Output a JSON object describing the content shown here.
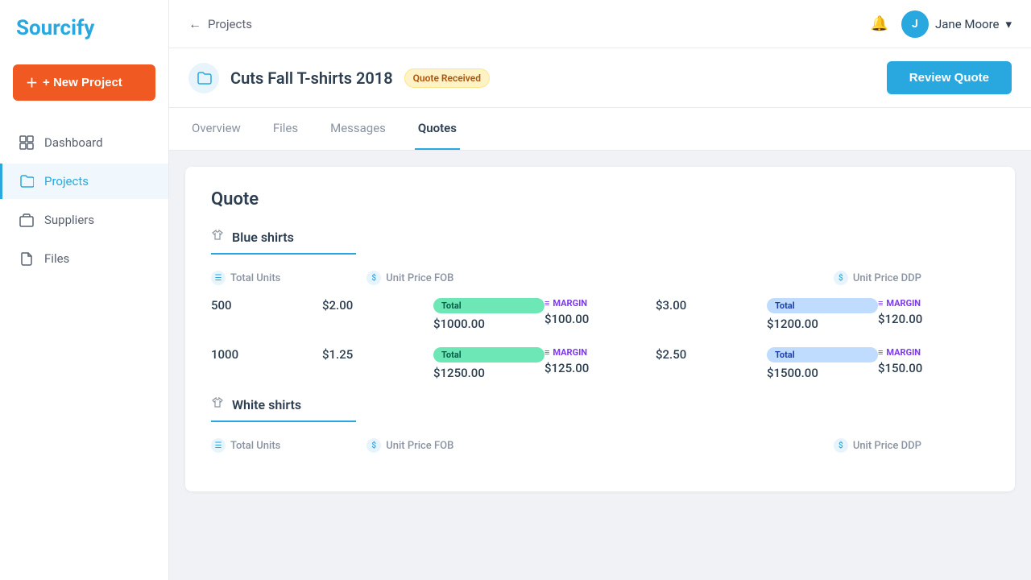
{
  "sidebar": {
    "logo": "Sourcify",
    "new_project_label": "+ New Project",
    "nav_items": [
      {
        "id": "dashboard",
        "label": "Dashboard",
        "active": false
      },
      {
        "id": "projects",
        "label": "Projects",
        "active": true
      },
      {
        "id": "suppliers",
        "label": "Suppliers",
        "active": false
      },
      {
        "id": "files",
        "label": "Files",
        "active": false
      }
    ]
  },
  "header": {
    "breadcrumb_label": "Projects",
    "notification_icon": "bell",
    "user": {
      "initial": "J",
      "name": "Jane Moore"
    }
  },
  "project": {
    "title": "Cuts Fall T-shirts 2018",
    "status": "Quote Received",
    "review_button": "Review Quote"
  },
  "tabs": [
    {
      "id": "overview",
      "label": "Overview",
      "active": false
    },
    {
      "id": "files",
      "label": "Files",
      "active": false
    },
    {
      "id": "messages",
      "label": "Messages",
      "active": false
    },
    {
      "id": "quotes",
      "label": "Quotes",
      "active": true
    }
  ],
  "quote": {
    "title": "Quote",
    "sections": [
      {
        "id": "blue-shirts",
        "name": "Blue shirts",
        "columns": {
          "total_units": "Total Units",
          "unit_price_fob": "Unit Price FOB",
          "unit_price_ddp": "Unit Price DDP"
        },
        "rows": [
          {
            "units": "500",
            "fob_price": "$2.00",
            "fob_total_label": "Total",
            "fob_total_value": "$1000.00",
            "fob_margin_label": "MARGIN",
            "fob_margin_value": "$100.00",
            "ddp_price": "$3.00",
            "ddp_total_label": "Total",
            "ddp_total_value": "$1200.00",
            "ddp_margin_label": "MARGIN",
            "ddp_margin_value": "$120.00"
          },
          {
            "units": "1000",
            "fob_price": "$1.25",
            "fob_total_label": "Total",
            "fob_total_value": "$1250.00",
            "fob_margin_label": "MARGIN",
            "fob_margin_value": "$125.00",
            "ddp_price": "$2.50",
            "ddp_total_label": "Total",
            "ddp_total_value": "$1500.00",
            "ddp_margin_label": "MARGIN",
            "ddp_margin_value": "$150.00"
          }
        ]
      },
      {
        "id": "white-shirts",
        "name": "White shirts",
        "columns": {
          "total_units": "Total Units",
          "unit_price_fob": "Unit Price FOB",
          "unit_price_ddp": "Unit Price DDP"
        },
        "rows": []
      }
    ]
  }
}
